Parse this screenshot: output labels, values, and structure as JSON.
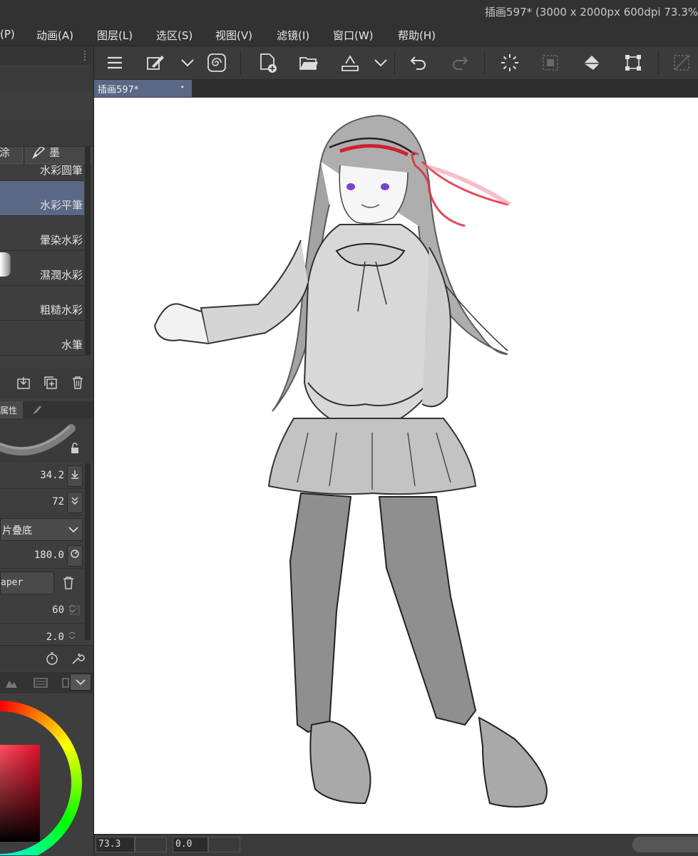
{
  "window": {
    "title": "插画597* (3000 x 2000px 600dpi 73.3%"
  },
  "menu": {
    "items": [
      "(P)",
      "动画(A)",
      "图层(L)",
      "选区(S)",
      "视图(V)",
      "滤镜(I)",
      "窗口(W)",
      "帮助(H)"
    ]
  },
  "toolbar": {
    "icons": [
      "menu-icon",
      "brush-edit-icon",
      "chevron-down-icon",
      "spiral-icon",
      "new-file-icon",
      "open-folder-icon",
      "save-icon",
      "chevron-down-icon",
      "undo-icon",
      "redo-icon",
      "loading-icon",
      "select-all-icon",
      "fill-icon",
      "transform-icon",
      "deselect-icon"
    ]
  },
  "document": {
    "tab_title": "插画597*",
    "tab_marker": "•"
  },
  "brush_panel": {
    "tabs": [
      {
        "label": "涂",
        "icon": null
      },
      {
        "label": "墨",
        "icon": "pen-icon"
      }
    ],
    "items": [
      {
        "label": "水彩圆筆",
        "selected": false
      },
      {
        "label": "水彩平筆",
        "selected": true
      },
      {
        "label": "暈染水彩",
        "selected": false
      },
      {
        "label": "濕潤水彩",
        "selected": false
      },
      {
        "label": "粗糙水彩",
        "selected": false
      },
      {
        "label": "水筆",
        "selected": false
      }
    ]
  },
  "tool_property": {
    "tab_label": "属性",
    "rows": {
      "brush_size": "34.2",
      "opacity": "72",
      "blend_mode": "片叠底",
      "angle": "180.0",
      "texture": "aper",
      "texture_density": "60",
      "last": "2.0"
    }
  },
  "status": {
    "zoom": "73.3",
    "rotation": "0.0"
  },
  "colors": {
    "accent_selected": "#5a6785",
    "ribbon_red": "#e02a3a",
    "eye_purple": "#7b3fd6"
  }
}
